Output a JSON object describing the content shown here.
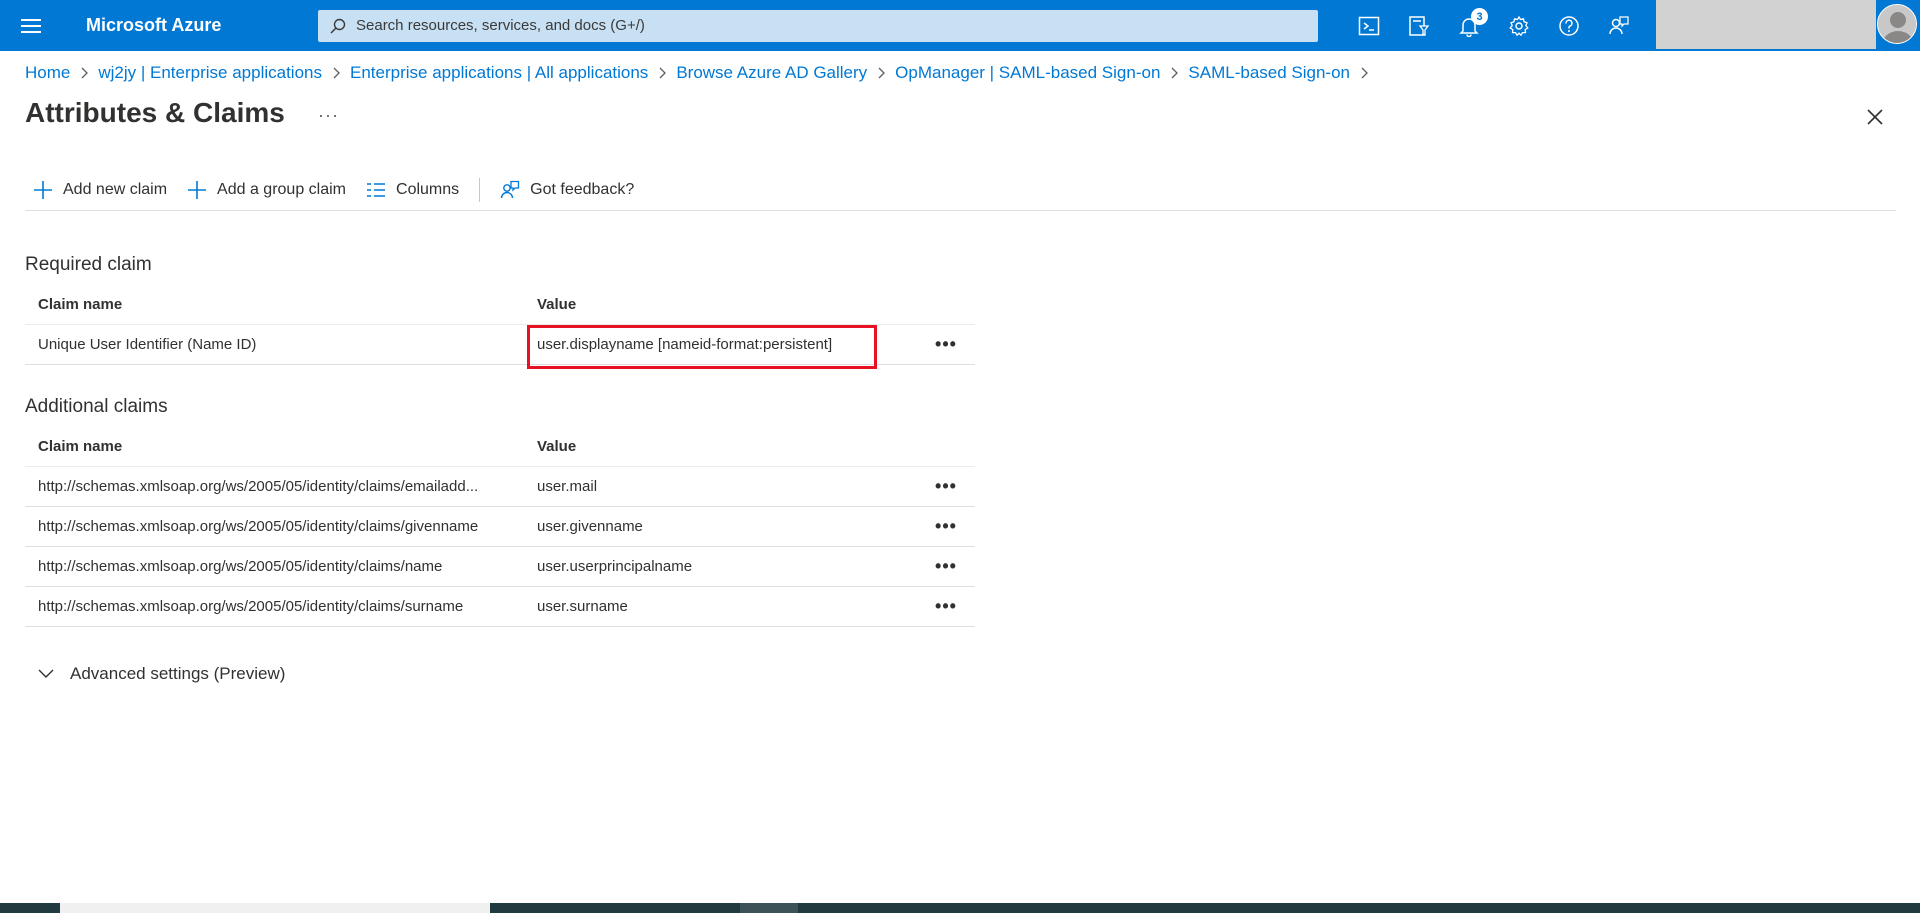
{
  "topbar": {
    "brand": "Microsoft Azure",
    "search_placeholder": "Search resources, services, and docs (G+/)",
    "notification_count": "3",
    "brand_color": "#0078d4"
  },
  "breadcrumb": [
    "Home",
    "wj2jy | Enterprise applications",
    "Enterprise applications | All applications",
    "Browse Azure AD Gallery",
    "OpManager | SAML-based Sign-on",
    "SAML-based Sign-on"
  ],
  "page": {
    "title": "Attributes & Claims",
    "more": "···"
  },
  "toolbar": {
    "add_new_claim": "Add new claim",
    "add_group_claim": "Add a group claim",
    "columns": "Columns",
    "feedback": "Got feedback?"
  },
  "required": {
    "title": "Required claim",
    "col_name": "Claim name",
    "col_value": "Value",
    "rows": [
      {
        "name": "Unique User Identifier (Name ID)",
        "value": "user.displayname [nameid-format:persistent]"
      }
    ]
  },
  "additional": {
    "title": "Additional claims",
    "col_name": "Claim name",
    "col_value": "Value",
    "rows": [
      {
        "name": "http://schemas.xmlsoap.org/ws/2005/05/identity/claims/emailadd...",
        "value": "user.mail"
      },
      {
        "name": "http://schemas.xmlsoap.org/ws/2005/05/identity/claims/givenname",
        "value": "user.givenname"
      },
      {
        "name": "http://schemas.xmlsoap.org/ws/2005/05/identity/claims/name",
        "value": "user.userprincipalname"
      },
      {
        "name": "http://schemas.xmlsoap.org/ws/2005/05/identity/claims/surname",
        "value": "user.surname"
      }
    ]
  },
  "row_more": "•••",
  "advanced": {
    "label": "Advanced settings (Preview)"
  }
}
